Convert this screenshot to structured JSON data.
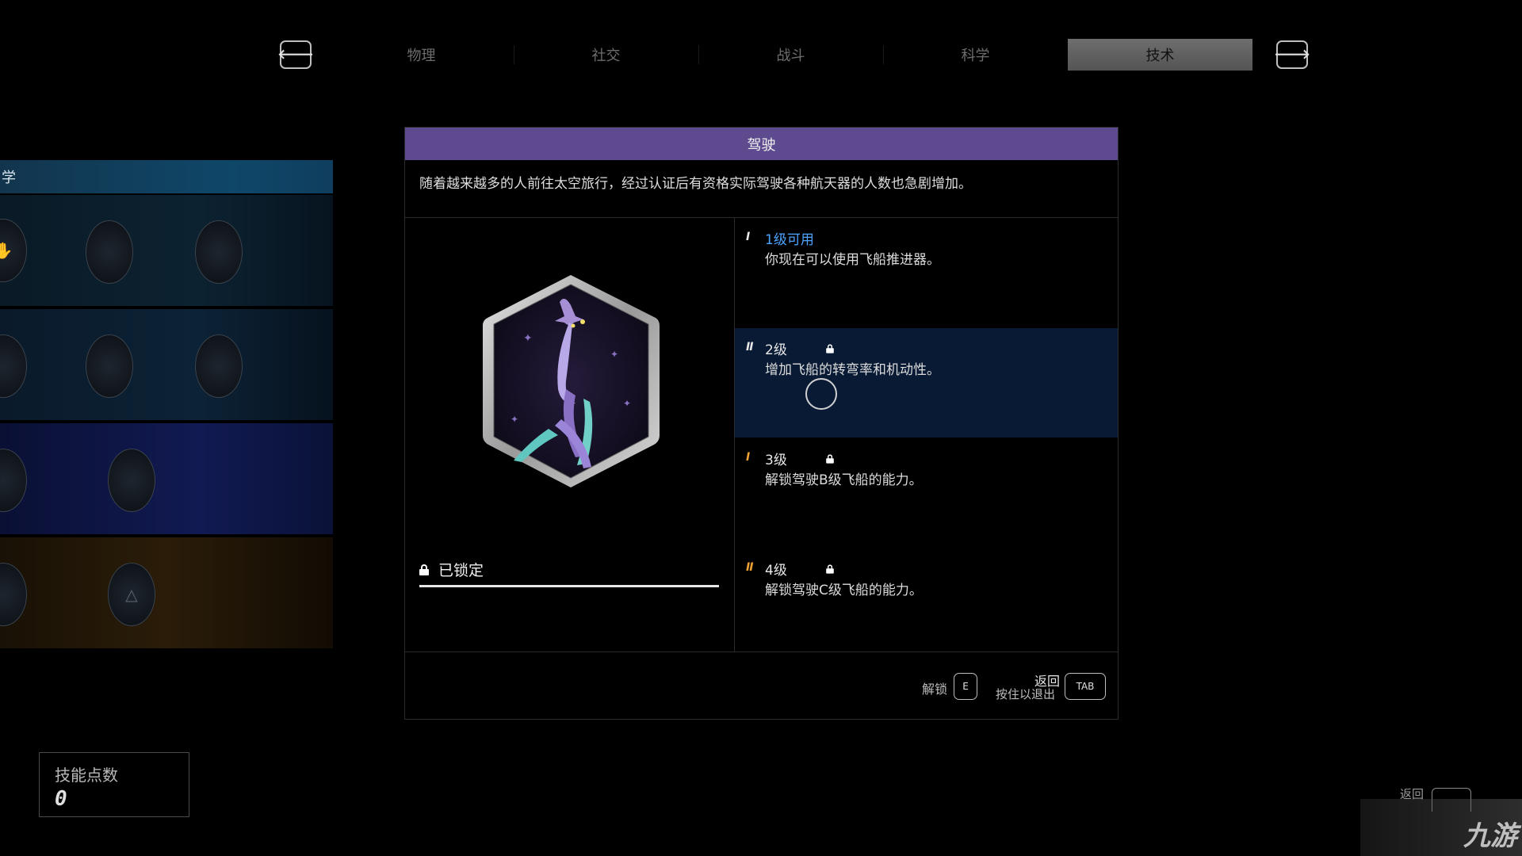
{
  "tabs": [
    {
      "label": "物理",
      "active": false
    },
    {
      "label": "社交",
      "active": false
    },
    {
      "label": "战斗",
      "active": false
    },
    {
      "label": "科学",
      "active": false
    },
    {
      "label": "技术",
      "active": true
    }
  ],
  "nav": {
    "prev_icon": "arrow-left-icon",
    "next_icon": "arrow-right-icon",
    "prev_glyph": "🡐",
    "next_glyph": "🡒"
  },
  "tree": {
    "header": "学"
  },
  "skill_points": {
    "label": "技能点数",
    "value": "0"
  },
  "skill": {
    "title": "驾驶",
    "description": "随着越来越多的人前往太空旅行，经过认证后有资格实际驾驶各种航天器的人数也急剧增加。",
    "status": "已锁定",
    "progress": 1.0,
    "ranks": [
      {
        "marker": "I",
        "marker_color": "#e8e8e8",
        "name": "1级可用",
        "available": true,
        "locked": false,
        "desc": "你现在可以使用飞船推进器。"
      },
      {
        "marker": "II",
        "marker_color": "#e8e8e8",
        "name": "2级",
        "available": false,
        "locked": true,
        "desc": "增加飞船的转弯率和机动性。"
      },
      {
        "marker": "I",
        "marker_color": "#f0a030",
        "name": "3级",
        "available": false,
        "locked": true,
        "desc": "解锁驾驶B级飞船的能力。"
      },
      {
        "marker": "II",
        "marker_color": "#f0a030",
        "name": "4级",
        "available": false,
        "locked": true,
        "desc": "解锁驾驶C级飞船的能力。"
      }
    ]
  },
  "footer": {
    "unlock_label": "解锁",
    "unlock_key": "E",
    "back_label": "返回",
    "back_hint": "按住以退出",
    "back_key": "TAB"
  },
  "corner": {
    "back_label": "返回",
    "watermark": "九游"
  },
  "colors": {
    "title_bar": "#5e4a8e",
    "rank_available": "#4da3ff",
    "rank_highlight": "#081a34",
    "marker_orange": "#f0a030"
  }
}
